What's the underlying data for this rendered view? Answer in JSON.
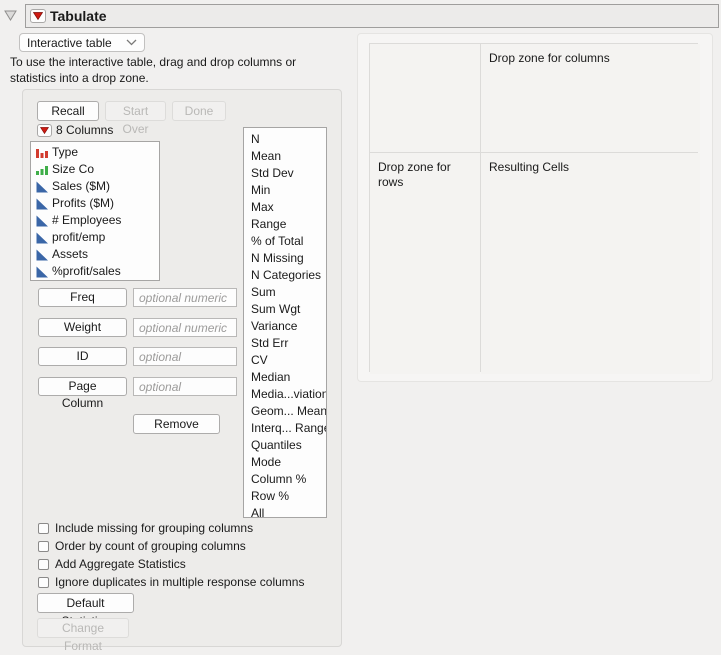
{
  "header": {
    "title": "Tabulate"
  },
  "toolbar": {
    "mode_combo_value": "Interactive table",
    "instructions": "To use the interactive table, drag and drop columns or statistics into a drop zone."
  },
  "control_panel": {
    "recall_label": "Recall",
    "start_over_label": "Start Over",
    "done_label": "Done",
    "columns_header": "8 Columns",
    "columns": [
      {
        "name": "Type",
        "type": "nominal"
      },
      {
        "name": "Size Co",
        "type": "ordinal"
      },
      {
        "name": "Sales ($M)",
        "type": "continuous"
      },
      {
        "name": "Profits ($M)",
        "type": "continuous"
      },
      {
        "name": "# Employees",
        "type": "continuous"
      },
      {
        "name": "profit/emp",
        "type": "continuous"
      },
      {
        "name": "Assets",
        "type": "continuous"
      },
      {
        "name": "%profit/sales",
        "type": "continuous"
      }
    ],
    "statistics": [
      "N",
      "Mean",
      "Std Dev",
      "Min",
      "Max",
      "Range",
      "% of Total",
      "N Missing",
      "N Categories",
      "Sum",
      "Sum Wgt",
      "Variance",
      "Std Err",
      "CV",
      "Median",
      "Media...viation",
      "Geom... Mean",
      "Interq... Range",
      "Quantiles",
      "Mode",
      "Column %",
      "Row %",
      "All"
    ],
    "cast_rows": [
      {
        "label": "Freq",
        "placeholder": "optional numeric"
      },
      {
        "label": "Weight",
        "placeholder": "optional numeric"
      },
      {
        "label": "ID",
        "placeholder": "optional"
      },
      {
        "label": "Page Column",
        "placeholder": "optional"
      }
    ],
    "remove_label": "Remove",
    "checkboxes": [
      {
        "label": "Include missing for grouping columns",
        "checked": false
      },
      {
        "label": "Order by count of grouping columns",
        "checked": false
      },
      {
        "label": "Add Aggregate Statistics",
        "checked": false
      },
      {
        "label": "Ignore duplicates in multiple response columns",
        "checked": false
      }
    ],
    "default_statistics_label": "Default Statistics",
    "change_format_label": "Change Format"
  },
  "drop_zones": {
    "columns_label": "Drop zone for columns",
    "rows_label": "Drop zone for rows",
    "cells_label": "Resulting Cells"
  },
  "colors": {
    "accent_red": "#cf1a12",
    "nominal_red": "#d23b2e",
    "ordinal_green": "#3fae49",
    "continuous_blue": "#3a66a7"
  }
}
